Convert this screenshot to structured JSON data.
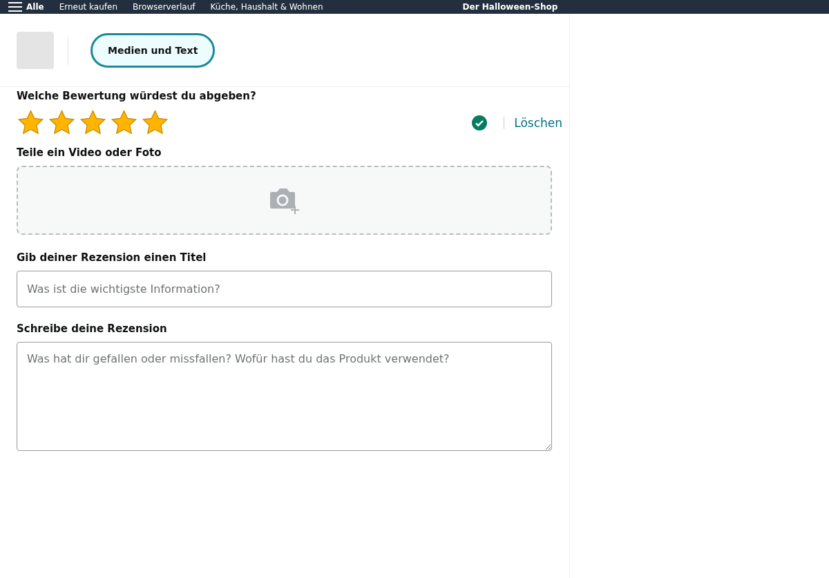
{
  "nav": {
    "menu_label": "Alle",
    "links": [
      "Erneut kaufen",
      "Browserverlauf",
      "Küche, Haushalt & Wohnen"
    ],
    "promo": "Der Halloween-Shop"
  },
  "mode_tab": {
    "label": "Medien und Text",
    "selected": true
  },
  "rating": {
    "question": "Welche Bewertung würdest du abgeben?",
    "stars": 5,
    "confirmed": true,
    "clear_link": "Löschen"
  },
  "media": {
    "label": "Teile ein Video oder Foto"
  },
  "title_field": {
    "label": "Gib deiner Rezension einen Titel",
    "placeholder": "Was ist die wichtigste Information?"
  },
  "review_field": {
    "label": "Schreibe deine Rezension",
    "placeholder": "Was hat dir gefallen oder missfallen? Wofür hast du das Produkt verwendet?"
  }
}
